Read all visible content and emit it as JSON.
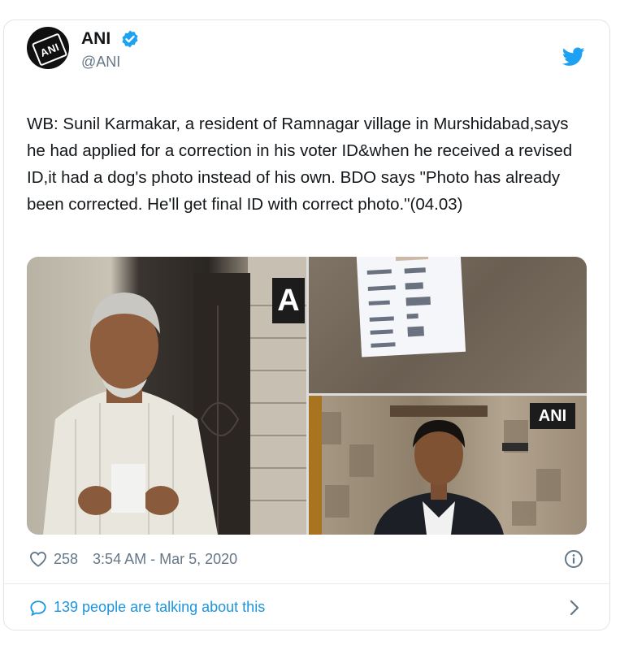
{
  "tweet": {
    "author_name": "ANI",
    "author_handle": "@ANI",
    "avatar_text": "ANI",
    "text": "WB: Sunil Karmakar, a resident of Ramnagar village in Murshidabad,says he had applied for a correction in his voter ID&when he received a revised ID,it had a dog's photo instead of his own. BDO says \"Photo has already been corrected. He'll get final ID with correct photo.\"(04.03)",
    "likes": "258",
    "timestamp": "3:54 AM - Mar 5, 2020",
    "talking_label": "139 people are talking about this"
  },
  "media": {
    "watermark_left": "A",
    "watermark_right": "ANI"
  },
  "colors": {
    "twitter_blue": "#1da1f2",
    "link_blue": "#1b95e0",
    "muted": "#657786"
  },
  "icons": [
    "verified-icon",
    "twitter-bird-icon",
    "heart-icon",
    "info-icon",
    "speech-bubble-icon",
    "chevron-right-icon"
  ]
}
